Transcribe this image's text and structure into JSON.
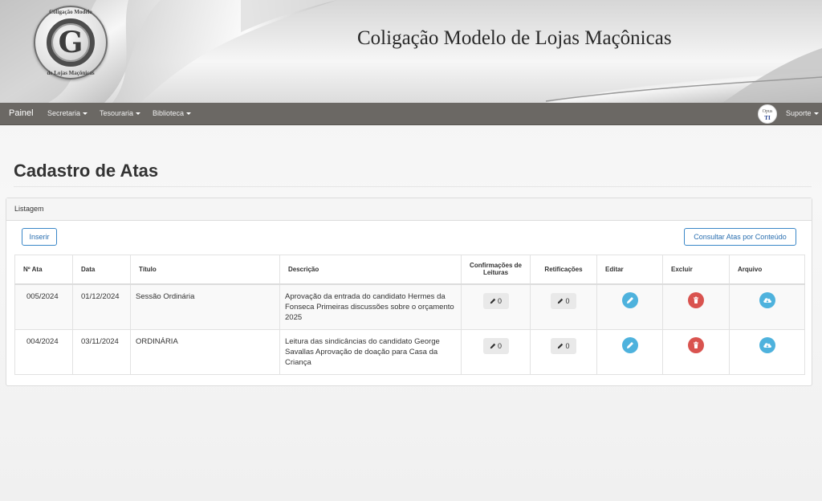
{
  "banner": {
    "site_title": "Coligação Modelo de Lojas Maçônicas",
    "logo_letter": "G",
    "logo_text_top": "Coligação Modelo",
    "logo_text_bottom": "de Lojas Maçônicas"
  },
  "navbar": {
    "brand": "Painel",
    "menus": [
      {
        "label": "Secretaria"
      },
      {
        "label": "Tesouraria"
      },
      {
        "label": "Biblioteca"
      }
    ],
    "avatar_top": "Opus",
    "avatar_bottom": "TI",
    "support_label": "Suporte"
  },
  "page": {
    "title": "Cadastro de Atas"
  },
  "panel": {
    "heading": "Listagem",
    "insert_label": "Inserir",
    "search_label": "Consultar Atas por Conteúdo"
  },
  "table": {
    "headers": {
      "numero": "Nº Ata",
      "data": "Data",
      "titulo": "Título",
      "descricao": "Descrição",
      "confirmacoes": "Confirmações de Leituras",
      "retificacoes": "Retificações",
      "editar": "Editar",
      "excluir": "Excluir",
      "arquivo": "Arquivo"
    },
    "rows": [
      {
        "numero": "005/2024",
        "data": "01/12/2024",
        "titulo": "Sessão Ordinária",
        "descricao": "Aprovação da entrada do candidato Hermes da Fonseca Primeiras discussões sobre o orçamento 2025",
        "confirmacoes": "0",
        "retificacoes": "0"
      },
      {
        "numero": "004/2024",
        "data": "03/11/2024",
        "titulo": "ORDINÁRIA",
        "descricao": "Leitura das sindicâncias do candidato George Savallas Aprovação de doação para Casa da Criança",
        "confirmacoes": "0",
        "retificacoes": "0"
      }
    ]
  },
  "colors": {
    "navbar": "#6b6864",
    "edit": "#4eb2dd",
    "delete": "#d9534f",
    "file": "#4eb2dd",
    "outline": "#3a87c8"
  },
  "icons": {
    "count": "pencil-icon",
    "edit": "pencil-icon",
    "delete": "trash-icon",
    "file": "cloud-download-icon"
  }
}
